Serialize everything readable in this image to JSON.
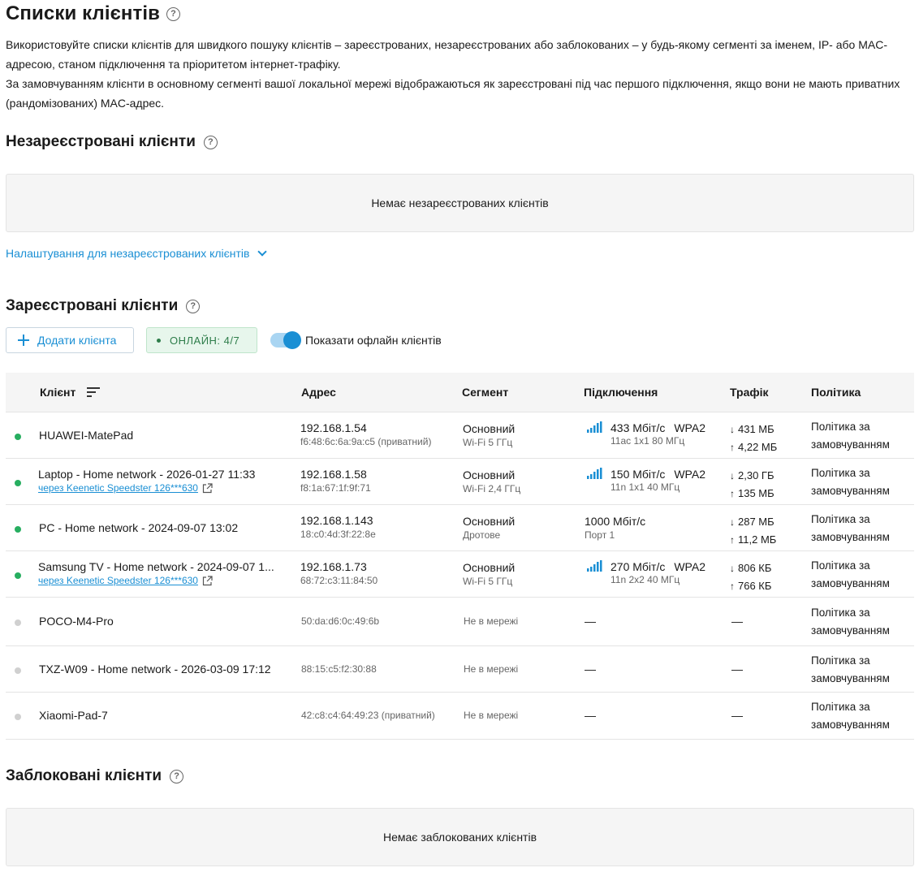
{
  "title": "Списки клієнтів",
  "help_glyph": "?",
  "description": "Використовуйте списки клієнтів для швидкого пошуку клієнтів – зареєстрованих, незареєстрованих або заблокованих – у будь-якому сегменті за іменем, IP- або MAC-адресою, станом підключення та пріоритетом інтернет-трафіку.",
  "description2": "За замовчуванням клієнти в основному сегменті вашої локальної мережі відображаються як зареєстровані під час першого підключення, якщо вони не мають приватних (рандомізованих) MAC-адрес.",
  "unregistered": {
    "heading": "Незареєстровані клієнти",
    "empty_text": "Немає незареєстрованих клієнтів",
    "settings_link": "Налаштування для незареєстрованих клієнтів"
  },
  "registered": {
    "heading": "Зареєстровані клієнти",
    "add_button": "Додати клієнта",
    "online_badge": "ОНЛАЙН: 4/7",
    "show_offline_label": "Показати офлайн клієнтів",
    "show_offline": true,
    "columns": [
      "Клієнт",
      "Адрес",
      "Сегмент",
      "Підключення",
      "Трафік",
      "Політика"
    ],
    "rows": [
      {
        "online": true,
        "name": "HUAWEI-MatePad",
        "via": "",
        "ip": "192.168.1.54",
        "mac": "f6:48:6c:6a:9a:c5 (приватний)",
        "segment": "Основний",
        "segment_sub": "Wi-Fi 5 ГГц",
        "speed": "433 Мбіт/с",
        "security": "WPA2",
        "conn_sub": "11ac 1x1 80 МГц",
        "wifi": true,
        "down": "431 МБ",
        "up": "4,22 МБ",
        "policy": "Політика за замовчуванням"
      },
      {
        "online": true,
        "name": "Laptop - Home network - 2026-01-27 11:33",
        "via": "через Keenetic Speedster 126***630",
        "ip": "192.168.1.58",
        "mac": "f8:1a:67:1f:9f:71",
        "segment": "Основний",
        "segment_sub": "Wi-Fi 2,4 ГГц",
        "speed": "150 Мбіт/с",
        "security": "WPA2",
        "conn_sub": "11n 1x1 40 МГц",
        "wifi": true,
        "down": "2,30 ГБ",
        "up": "135 МБ",
        "policy": "Політика за замовчуванням"
      },
      {
        "online": true,
        "name": "PC - Home network - 2024-09-07 13:02",
        "via": "",
        "ip": "192.168.1.143",
        "mac": "18:c0:4d:3f:22:8e",
        "segment": "Основний",
        "segment_sub": "Дротове",
        "speed": "1000 Мбіт/с",
        "security": "",
        "conn_sub": "Порт 1",
        "wifi": false,
        "down": "287 МБ",
        "up": "11,2 МБ",
        "policy": "Політика за замовчуванням"
      },
      {
        "online": true,
        "name": "Samsung TV - Home network - 2024-09-07 1...",
        "via": "через Keenetic Speedster 126***630",
        "ip": "192.168.1.73",
        "mac": "68:72:c3:11:84:50",
        "segment": "Основний",
        "segment_sub": "Wi-Fi 5 ГГц",
        "speed": "270 Мбіт/с",
        "security": "WPA2",
        "conn_sub": "11n 2x2 40 МГц",
        "wifi": true,
        "down": "806 КБ",
        "up": "766 КБ",
        "policy": "Політика за замовчуванням"
      },
      {
        "online": false,
        "name": "POCO-M4-Pro",
        "mac": "50:da:d6:0c:49:6b",
        "segment_status": "Не в мережі",
        "conn": "—",
        "traffic": "—",
        "policy": "Політика за замовчуванням"
      },
      {
        "online": false,
        "name": "TXZ-W09 - Home network - 2026-03-09 17:12",
        "mac": "88:15:c5:f2:30:88",
        "segment_status": "Не в мережі",
        "conn": "—",
        "traffic": "—",
        "policy": "Політика за замовчуванням"
      },
      {
        "online": false,
        "name": "Xiaomi-Pad-7",
        "mac": "42:c8:c4:64:49:23 (приватний)",
        "segment_status": "Не в мережі",
        "conn": "—",
        "traffic": "—",
        "policy": "Політика за замовчуванням"
      }
    ]
  },
  "blocked": {
    "heading": "Заблоковані клієнти",
    "empty_text": "Немає заблокованих клієнтів"
  },
  "colors": {
    "accent": "#1a8fd4",
    "online": "#27ae60",
    "offline": "#d0d0d0",
    "badge_bg": "#e7f6ec"
  },
  "icons": {
    "help": "help-circle-icon",
    "add": "plus-icon",
    "chevron": "chevron-down-icon",
    "sort": "sort-icon",
    "external": "external-link-icon",
    "signal": "wifi-signal-icon",
    "down_arrow": "↓",
    "up_arrow": "↑"
  }
}
